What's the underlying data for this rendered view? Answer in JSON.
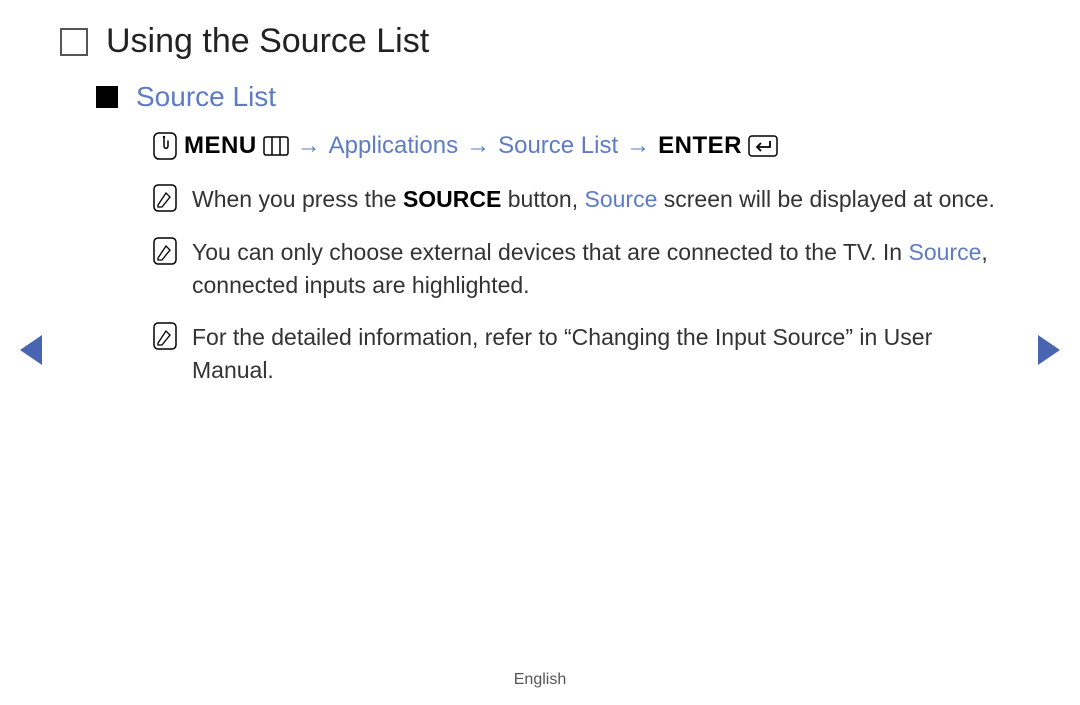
{
  "title": "Using the Source List",
  "subtitle": "Source List",
  "nav_path": {
    "menu_label": "MENU",
    "step1": "Applications",
    "step2": "Source List",
    "enter_label": "ENTER",
    "arrow": "→"
  },
  "notes": [
    {
      "pre": "When you press the ",
      "bold": "SOURCE",
      "mid": " button, ",
      "link": "Source",
      "post": " screen will be displayed at once."
    },
    {
      "pre": "You can only choose external devices that are connected to the TV. In ",
      "link": "Source",
      "post": ", connected inputs are highlighted."
    },
    {
      "pre": "For the detailed information, refer to “Changing the Input Source” in User Manual."
    }
  ],
  "footer": "English"
}
